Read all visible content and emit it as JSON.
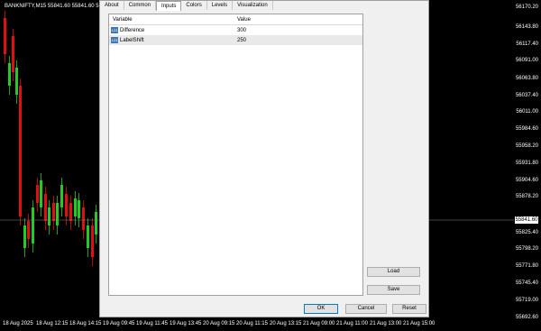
{
  "chart": {
    "title": "BANKNIFTY,M15  55841.60 55841.60 55",
    "price_labels": [
      "56170.20",
      "56143.80",
      "56117.40",
      "56091.00",
      "56063.80",
      "56037.40",
      "56011.00",
      "55984.60",
      "55958.20",
      "55931.80",
      "55904.60",
      "55878.20",
      "55825.40",
      "55798.20",
      "55771.80",
      "55745.40",
      "55719.00",
      "55692.60"
    ],
    "current_price": "55841.60",
    "time_labels": [
      "18 Aug 2025",
      "18 Aug 12:15",
      "18 Aug 14:15",
      "19 Aug 09:45",
      "19 Aug 11:45",
      "19 Aug 13:45",
      "20 Aug 09:15",
      "20 Aug 11:15",
      "20 Aug 13:15",
      "21 Aug 09:00",
      "21 Aug 11:00",
      "21 Aug 13:00",
      "21 Aug 15:00"
    ],
    "colors": {
      "bull": "#22cc22",
      "bear": "#e01010",
      "grid": "#888888"
    }
  },
  "dialog": {
    "tabs": [
      "About",
      "Common",
      "Inputs",
      "Colors",
      "Levels",
      "Visualization"
    ],
    "active_tab": "Inputs",
    "grid": {
      "headers": {
        "variable": "Variable",
        "value": "Value"
      },
      "rows": [
        {
          "icon": "int-type-icon",
          "icon_text": "123",
          "name": "Difference",
          "value": "300"
        },
        {
          "icon": "int-type-icon",
          "icon_text": "123",
          "name": "LabelShift",
          "value": "250"
        }
      ]
    },
    "buttons": {
      "load": "Load",
      "save": "Save",
      "ok": "OK",
      "cancel": "Cancel",
      "reset": "Reset"
    }
  }
}
